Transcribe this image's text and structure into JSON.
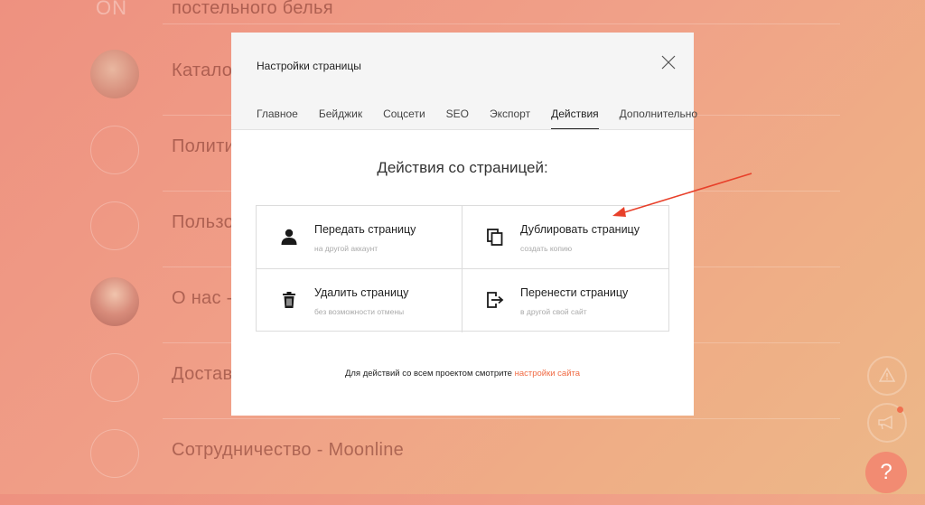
{
  "background": {
    "logo": "ON",
    "status_text": "",
    "pages": [
      {
        "title": "постельного белья"
      },
      {
        "title": "Катало"
      },
      {
        "title": "Полити"
      },
      {
        "title": "Пользо"
      },
      {
        "title": "О нас -"
      },
      {
        "title": "Достав"
      },
      {
        "title": "Сотрудничество - Moonline"
      }
    ]
  },
  "modal": {
    "title": "Настройки страницы",
    "tabs": [
      "Главное",
      "Бейджик",
      "Соцсети",
      "SEO",
      "Экспорт",
      "Действия",
      "Дополнительно"
    ],
    "active_tab": "Действия",
    "section_title": "Действия со страницей:",
    "actions": [
      {
        "label": "Передать страницу",
        "sub": "на другой аккаунт",
        "icon": "user-icon"
      },
      {
        "label": "Дублировать страницу",
        "sub": "создать копию",
        "icon": "copy-icon"
      },
      {
        "label": "Удалить страницу",
        "sub": "без возможности отмены",
        "icon": "trash-icon"
      },
      {
        "label": "Перенести страницу",
        "sub": "в другой свой сайт",
        "icon": "move-icon"
      }
    ],
    "footer_text": "Для действий со всем проектом смотрите",
    "footer_link": "настройки сайта"
  },
  "help_label": "?",
  "colors": {
    "accent": "#f06a43",
    "annotation_arrow": "#e8402a",
    "help_button": "#f28b72"
  }
}
